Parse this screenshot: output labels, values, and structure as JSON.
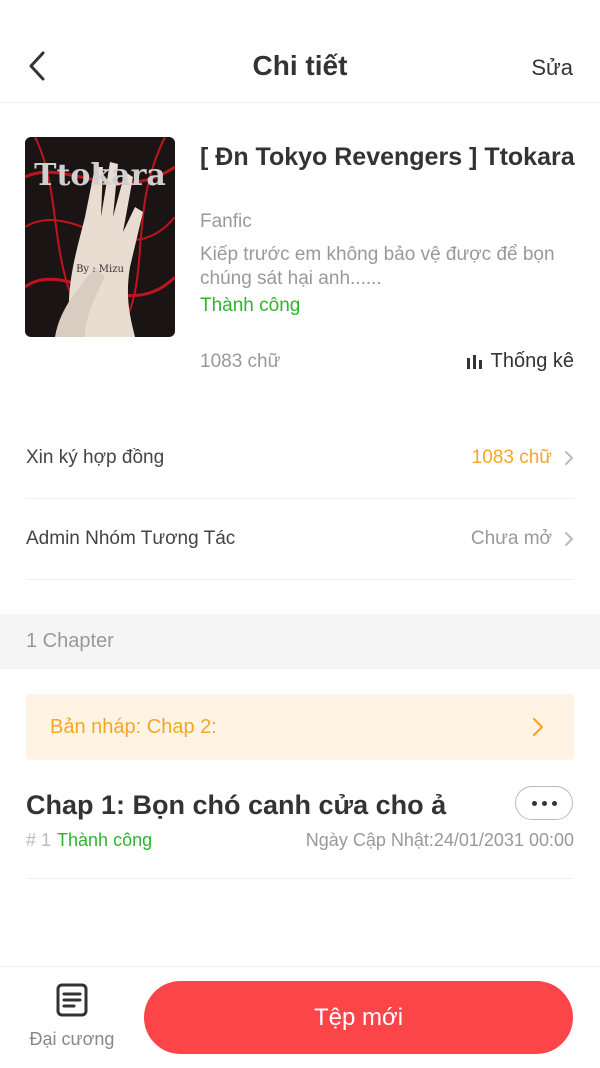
{
  "header": {
    "title": "Chi tiết",
    "edit_label": "Sửa"
  },
  "book": {
    "cover_title": "Ttokara",
    "cover_author": "By : Mizu",
    "title": "[ Đn Tokyo Revengers ] Ttokara",
    "genre": "Fanfic",
    "description": "Kiếp trước em không bảo vệ được để bọn chúng sát hại anh......",
    "status": "Thành công",
    "word_count": "1083 chữ",
    "stats_label": "Thống kê"
  },
  "rows": [
    {
      "label": "Xin ký hợp đồng",
      "value": "1083 chữ",
      "value_color": "#f5a623"
    },
    {
      "label": "Admin Nhóm Tương Tác",
      "value": "Chưa mở",
      "value_color": "#999999"
    }
  ],
  "chapters_section": {
    "label": "1 Chapter"
  },
  "draft": {
    "label": "Bản nháp: Chap 2:"
  },
  "chapters": [
    {
      "title": "Chap 1: Bọn chó canh cửa cho ả",
      "index": "# 1",
      "status": "Thành công",
      "updated": "Ngày Cập Nhật:24/01/2031 00:00"
    }
  ],
  "bottom": {
    "outline_label": "Đại cương",
    "new_button_label": "Tệp mới"
  },
  "colors": {
    "accent": "#fc4548",
    "success": "#2db52d",
    "warning": "#f5a623"
  }
}
